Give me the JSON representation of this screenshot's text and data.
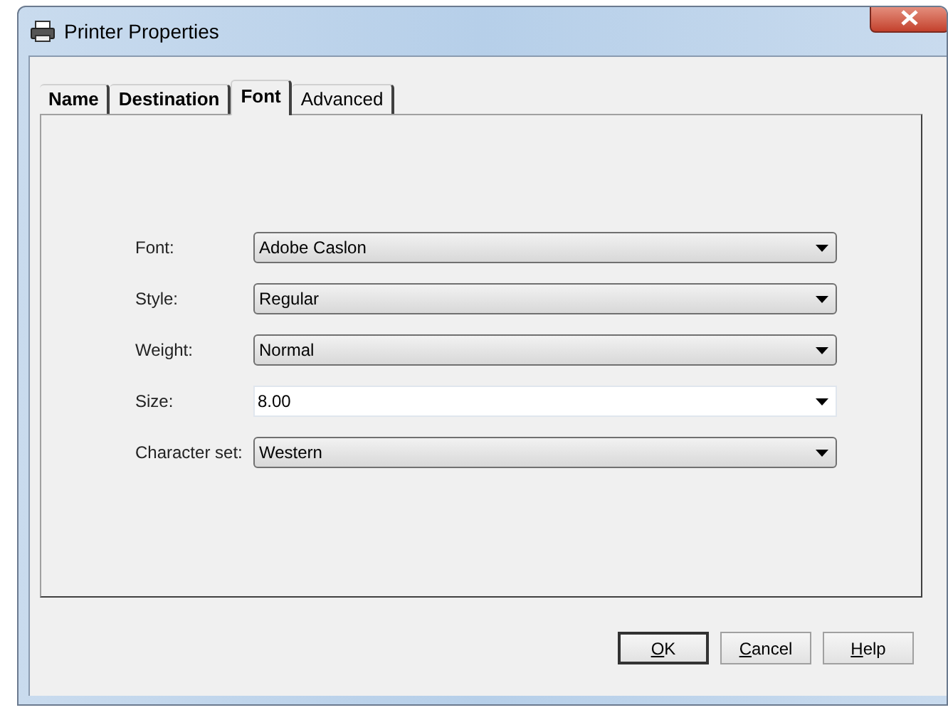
{
  "window": {
    "title": "Printer Properties"
  },
  "tabs": [
    {
      "label": "Name",
      "selected": false
    },
    {
      "label": "Destination",
      "selected": false
    },
    {
      "label": "Font",
      "selected": true
    },
    {
      "label": "Advanced",
      "selected": false
    }
  ],
  "fields": [
    {
      "label": "Font:",
      "value": "Adobe Caslon",
      "kind": "dropdown"
    },
    {
      "label": "Style:",
      "value": "Regular",
      "kind": "dropdown"
    },
    {
      "label": "Weight:",
      "value": "Normal",
      "kind": "dropdown"
    },
    {
      "label": "Size:",
      "value": "8.00",
      "kind": "combo"
    },
    {
      "label": "Character set:",
      "value": "Western",
      "kind": "dropdown"
    }
  ],
  "buttons": [
    {
      "access_key": "O",
      "rest": "K",
      "default": true
    },
    {
      "access_key": "C",
      "rest": "ancel",
      "default": false
    },
    {
      "access_key": "H",
      "rest": "elp",
      "default": false
    }
  ]
}
